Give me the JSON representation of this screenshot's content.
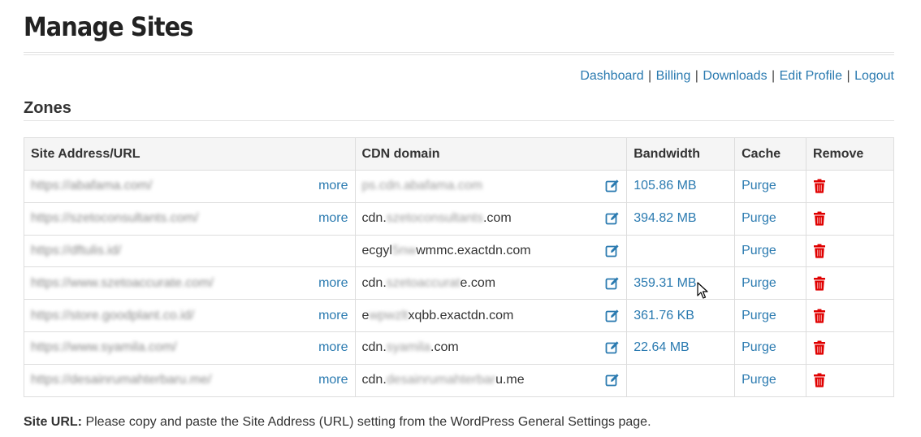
{
  "page": {
    "title": "Manage Sites"
  },
  "nav": {
    "items": [
      "Dashboard",
      "Billing",
      "Downloads",
      "Edit Profile",
      "Logout"
    ],
    "separator": "|"
  },
  "zones": {
    "title": "Zones",
    "headers": {
      "site": "Site Address/URL",
      "cdn": "CDN domain",
      "bandwidth": "Bandwidth",
      "cache": "Cache",
      "remove": "Remove"
    },
    "more_label": "more",
    "purge_label": "Purge",
    "rows": [
      {
        "site": "https://abafama.com/",
        "has_more": true,
        "cdn_prefix": "",
        "cdn_blur": "ps.cdn.abafama.com",
        "cdn_suffix": "",
        "bandwidth": "105.86 MB"
      },
      {
        "site": "https://szetoconsultants.com/",
        "has_more": true,
        "cdn_prefix": "cdn.",
        "cdn_blur": "szetoconsultants",
        "cdn_suffix": ".com",
        "bandwidth": "394.82 MB"
      },
      {
        "site": "https://dftulis.id/",
        "has_more": false,
        "cdn_prefix": "ecgyl",
        "cdn_blur": "5nw",
        "cdn_suffix": "wmmc.exactdn.com",
        "bandwidth": ""
      },
      {
        "site": "https://www.szetoaccurate.com/",
        "has_more": true,
        "cdn_prefix": "cdn.",
        "cdn_blur": "szetoaccurat",
        "cdn_suffix": "e.com",
        "bandwidth": "359.31 MB"
      },
      {
        "site": "https://store.goodplant.co.id/",
        "has_more": true,
        "cdn_prefix": "e",
        "cdn_blur": "wpwzlt",
        "cdn_suffix": "xqbb.exactdn.com",
        "bandwidth": "361.76 KB"
      },
      {
        "site": "https://www.syamila.com/",
        "has_more": true,
        "cdn_prefix": "cdn.",
        "cdn_blur": "syamila",
        "cdn_suffix": ".com",
        "bandwidth": "22.64 MB"
      },
      {
        "site": "https://desainrumahterbaru.me/",
        "has_more": true,
        "cdn_prefix": "cdn.",
        "cdn_blur": "desainrumahterbar",
        "cdn_suffix": "u.me",
        "bandwidth": ""
      }
    ]
  },
  "footnote": {
    "label": "Site URL:",
    "text": " Please copy and paste the Site Address (URL) setting from the WordPress General Settings page."
  },
  "icons": {
    "edit": "edit-icon",
    "remove": "trash-icon",
    "cursor": "mouse-pointer-icon"
  },
  "colors": {
    "link": "#2a7ab0",
    "trash": "#e00000",
    "header_bg": "#f5f5f5",
    "border": "#dddddd"
  }
}
